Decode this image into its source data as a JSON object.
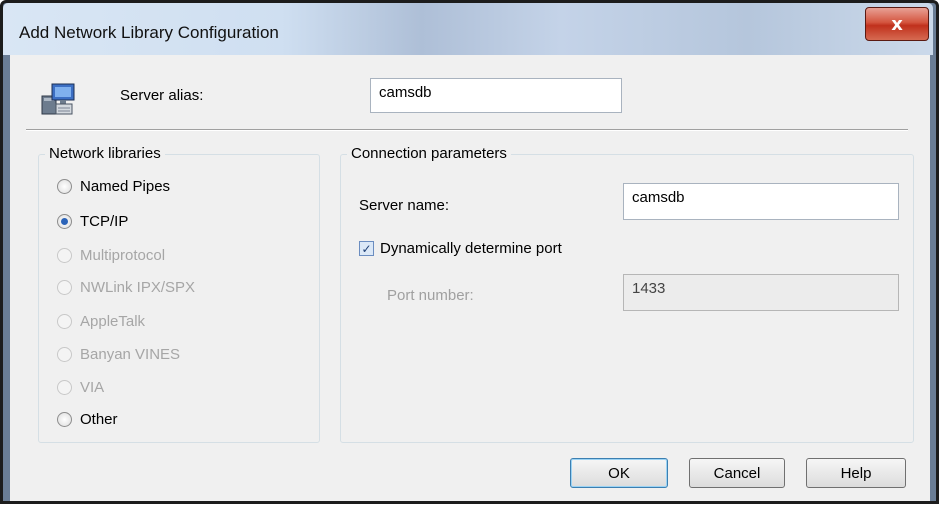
{
  "window": {
    "title": "Add Network Library Configuration",
    "close_glyph": "x"
  },
  "server_alias": {
    "label": "Server alias:",
    "value": "camsdb",
    "icon": "network-computers-icon"
  },
  "network_libraries": {
    "legend": "Network libraries",
    "options": [
      {
        "label": "Named Pipes",
        "checked": false,
        "enabled": true
      },
      {
        "label": "TCP/IP",
        "checked": true,
        "enabled": true
      },
      {
        "label": "Multiprotocol",
        "checked": false,
        "enabled": false
      },
      {
        "label": "NWLink IPX/SPX",
        "checked": false,
        "enabled": false
      },
      {
        "label": "AppleTalk",
        "checked": false,
        "enabled": false
      },
      {
        "label": "Banyan VINES",
        "checked": false,
        "enabled": false
      },
      {
        "label": "VIA",
        "checked": false,
        "enabled": false
      },
      {
        "label": "Other",
        "checked": false,
        "enabled": true
      }
    ]
  },
  "connection_parameters": {
    "legend": "Connection parameters",
    "server_name_label": "Server name:",
    "server_name_value": "camsdb",
    "dynamic_port_label": "Dynamically determine port",
    "dynamic_port_checked": true,
    "port_label": "Port number:",
    "port_value": "1433"
  },
  "buttons": {
    "ok": "OK",
    "cancel": "Cancel",
    "help": "Help"
  }
}
